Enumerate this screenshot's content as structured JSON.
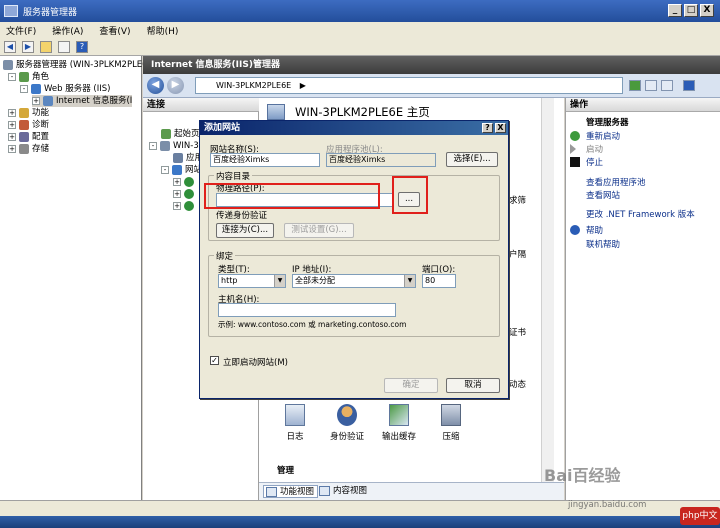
{
  "window": {
    "title": "服务器管理器"
  },
  "menu": [
    "文件(F)",
    "操作(A)",
    "查看(V)",
    "帮助(H)"
  ],
  "tree": {
    "root": "服务器管理器 (WIN-3PLKM2PLE6",
    "roles": "角色",
    "web_server": "Web 服务器 (IIS)",
    "iis_manager": "Internet 信息服务(I",
    "features": "功能",
    "diagnostics": "诊断",
    "config": "配置",
    "storage": "存储"
  },
  "iis": {
    "header": "Internet 信息服务(IIS)管理器",
    "address": "WIN-3PLKM2PLE6E",
    "address_arrow": "▶"
  },
  "connections": {
    "title": "连接",
    "start_page": "起始页",
    "server_short": "WIN-3P",
    "apps": "应用",
    "sites": "网站"
  },
  "home": {
    "title": "WIN-3PLKM2PLE6E 主页",
    "features": [
      {
        "label": "日志"
      },
      {
        "label": "身份验证"
      },
      {
        "label": "输出缓存"
      },
      {
        "label": "压缩"
      }
    ],
    "side_labels": [
      "求筛",
      "户隔",
      "证书",
      "动态"
    ],
    "section": "管理"
  },
  "view_tabs": {
    "features": "功能视图",
    "content": "内容视图"
  },
  "actions": {
    "title": "操作",
    "group": "管理服务器",
    "restart": "重新启动",
    "start": "启动",
    "stop": "停止",
    "view_app_pools": "查看应用程序池",
    "view_sites": "查看网站",
    "change_net": "更改 .NET Framework 版本",
    "help": "帮助",
    "online_help": "联机帮助"
  },
  "dialog": {
    "title": "添加网站",
    "site_name_label": "网站名称(S):",
    "site_name_value": "百度经验Ximks",
    "app_pool_label": "应用程序池(L):",
    "app_pool_value": "百度经验Ximks",
    "select_button": "选择(E)...",
    "content_dir_label": "内容目录",
    "physical_path_label": "物理路径(P):",
    "physical_path_value": "",
    "browse_button": "...",
    "pass_auth_label": "传递身份验证",
    "connect_as_button": "连接为(C)...",
    "test_settings_button": "测试设置(G)...",
    "binding_label": "绑定",
    "type_label": "类型(T):",
    "type_value": "http",
    "ip_label": "IP 地址(I):",
    "ip_value": "全部未分配",
    "port_label": "端口(O):",
    "port_value": "80",
    "host_label": "主机名(H):",
    "host_value": "",
    "example": "示例: www.contoso.com 或 marketing.contoso.com",
    "start_immediately": "立即启动网站(M)",
    "start_checked": "✓",
    "ok_button": "确定",
    "cancel_button": "取消",
    "help_btn": "?",
    "close_btn": "X"
  },
  "watermark": {
    "brand": "Bai百经验",
    "url": "jingyan.baidu.com",
    "site": "php中文网"
  },
  "colors": {
    "highlight": "#e0201b",
    "title_blue": "#0a246a"
  },
  "icons": {
    "back": "◀",
    "forward": "▶",
    "minimize": "_",
    "maximize": "□",
    "close": "X",
    "expand": "+",
    "collapse": "-"
  }
}
